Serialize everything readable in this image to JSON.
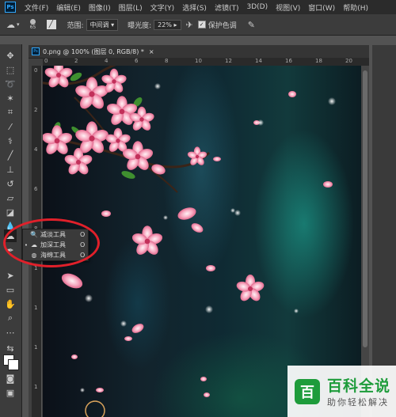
{
  "menubar": {
    "logo": "Ps",
    "items": [
      "文件(F)",
      "编辑(E)",
      "图像(I)",
      "图层(L)",
      "文字(Y)",
      "选择(S)",
      "滤镜(T)",
      "3D(D)",
      "视图(V)",
      "窗口(W)",
      "帮助(H)"
    ]
  },
  "options": {
    "brush_size": "65",
    "range_label": "范围:",
    "range_value": "中间调",
    "exposure_label": "曝光度:",
    "exposure_value": "22%",
    "protect_tones_label": "保护色调"
  },
  "document": {
    "tab_title": "0.png @ 100% (图层 0, RGB/8) *",
    "close": "×",
    "ruler_h": [
      "0",
      "2",
      "4",
      "6",
      "8",
      "10",
      "12",
      "14",
      "16",
      "18",
      "20"
    ],
    "ruler_v": [
      "0",
      "2",
      "4",
      "6",
      "8",
      "1",
      "1",
      "1",
      "1"
    ]
  },
  "tool_popup": {
    "items": [
      {
        "label": "减淡工具",
        "key": "O",
        "icon": "dodge-icon",
        "selected": false
      },
      {
        "label": "加深工具",
        "key": "O",
        "icon": "burn-icon",
        "selected": true
      },
      {
        "label": "海绵工具",
        "key": "O",
        "icon": "sponge-icon",
        "selected": false
      }
    ]
  },
  "watermark": {
    "title": "百科全说",
    "subtitle": "助你轻松解决",
    "color": "#1e9c3b"
  }
}
